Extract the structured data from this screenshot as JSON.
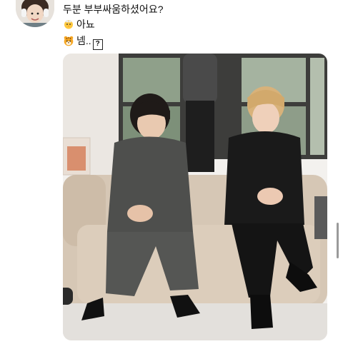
{
  "avatar": {
    "icon": "profile-photo"
  },
  "messages": [
    {
      "text": "두분 부부싸움하셨어요?"
    },
    {
      "emoji": "chick-icon",
      "text": "아뇨"
    },
    {
      "emoji": "tiger-icon",
      "text": "넴..",
      "trailing_glyph": "?"
    }
  ],
  "photo": {
    "description_icon": "photo-two-men-on-sofa"
  }
}
